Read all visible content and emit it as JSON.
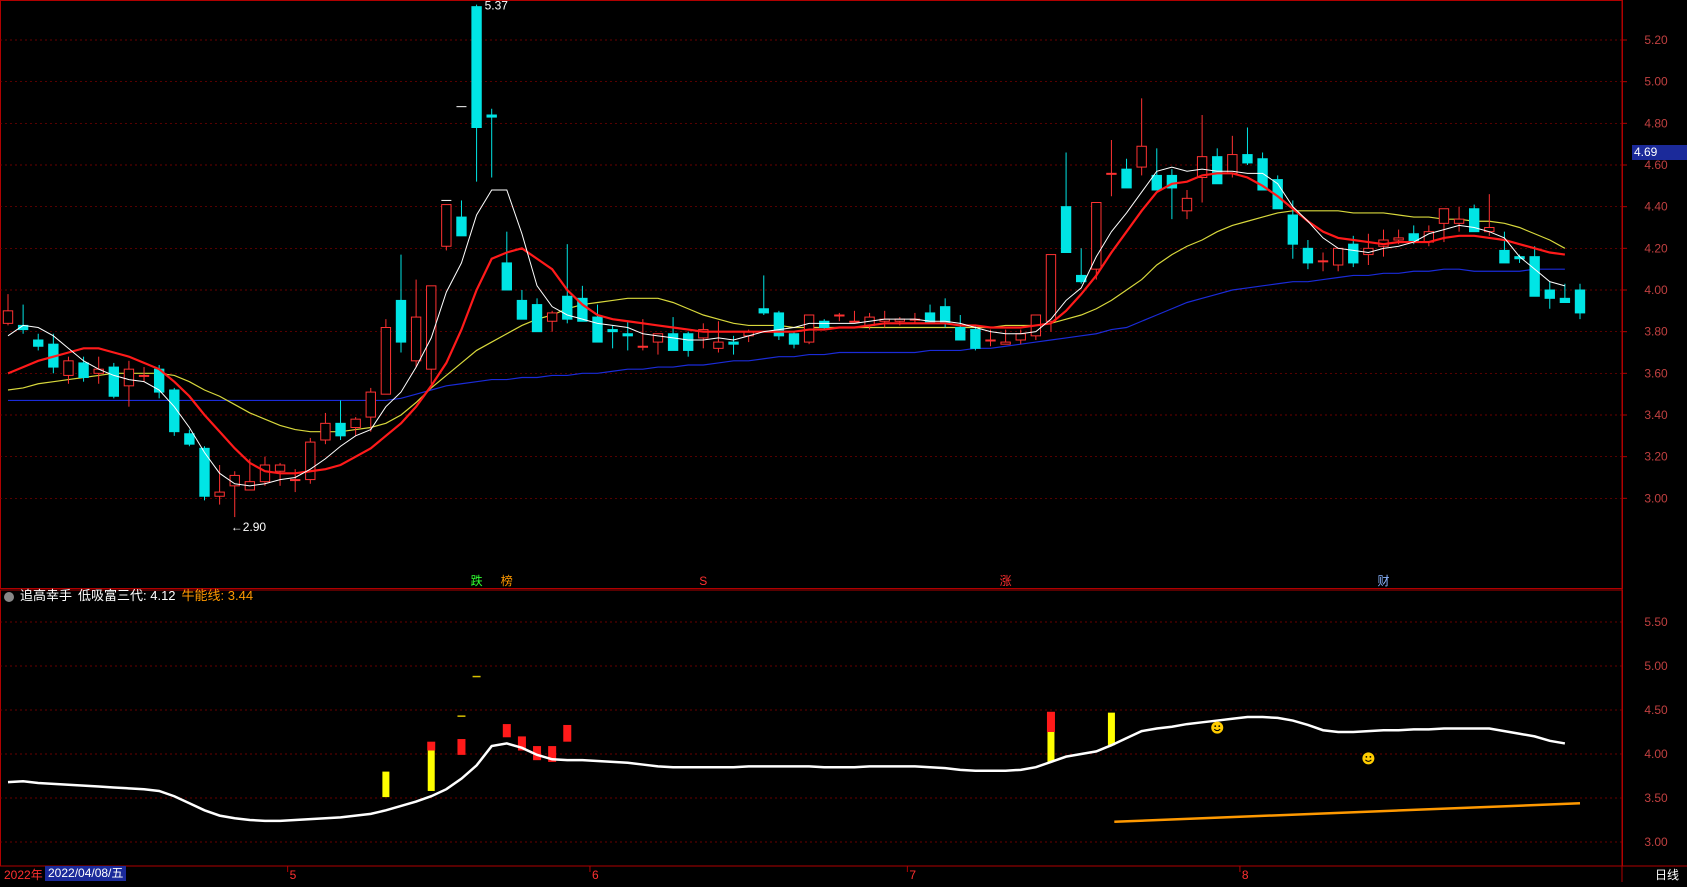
{
  "colors": {
    "up": "#ff3232",
    "down": "#00e5e5",
    "ma5": "#ffffff",
    "ma10": "#ff1a1a",
    "ma20": "#d8d83c",
    "ma60": "#1a2bd8",
    "grid": "#8b0000",
    "axis": "#c0c0c0",
    "sub_line": "#ffffff",
    "sub_niu": "#ff9900"
  },
  "main": {
    "current_price_label": "4.69",
    "high_marker": "5.37",
    "low_marker": "←2.90",
    "event_tags": [
      {
        "text": "跌",
        "color": "#30ff30"
      },
      {
        "text": "榜",
        "color": "#ff9900"
      },
      {
        "text": "S",
        "color": "#ff3030"
      },
      {
        "text": "涨",
        "color": "#ff3030"
      },
      {
        "text": "财",
        "color": "#8ab4ff"
      }
    ]
  },
  "sub": {
    "indicator_name": "追高幸手",
    "line1_label": "低吸富三代: 4.12",
    "line2_label": "牛能线: 3.44",
    "smiley_icon": "smiley-face-icon"
  },
  "xaxis": {
    "year_label": "2022年",
    "cursor_date": "2022/04/08/五",
    "month_labels": [
      "5",
      "6",
      "7",
      "8"
    ],
    "period": "日线"
  },
  "chart_data": [
    {
      "type": "candlestick",
      "title": "",
      "ylim": [
        2.8,
        5.4
      ],
      "yticks": [
        "5.20",
        "5.00",
        "4.80",
        "4.60",
        "4.40",
        "4.20",
        "4.00",
        "3.80",
        "3.60",
        "3.40",
        "3.20",
        "3.00"
      ],
      "candles": [
        [
          3.84,
          3.98,
          3.83,
          3.9
        ],
        [
          3.83,
          3.93,
          3.79,
          3.81
        ],
        [
          3.76,
          3.79,
          3.71,
          3.73
        ],
        [
          3.74,
          3.79,
          3.6,
          3.63
        ],
        [
          3.59,
          3.68,
          3.55,
          3.66
        ],
        [
          3.65,
          3.68,
          3.56,
          3.58
        ],
        [
          3.6,
          3.68,
          3.55,
          3.62
        ],
        [
          3.63,
          3.65,
          3.48,
          3.49
        ],
        [
          3.54,
          3.66,
          3.44,
          3.62
        ],
        [
          3.59,
          3.63,
          3.56,
          3.59
        ],
        [
          3.62,
          3.64,
          3.48,
          3.51
        ],
        [
          3.52,
          3.53,
          3.3,
          3.32
        ],
        [
          3.31,
          3.33,
          3.25,
          3.26
        ],
        [
          3.24,
          3.25,
          2.99,
          3.01
        ],
        [
          3.01,
          3.16,
          2.97,
          3.03
        ],
        [
          3.06,
          3.13,
          2.91,
          3.11
        ],
        [
          3.04,
          3.19,
          3.04,
          3.08
        ],
        [
          3.08,
          3.2,
          3.06,
          3.16
        ],
        [
          3.13,
          3.17,
          3.06,
          3.16
        ],
        [
          3.09,
          3.14,
          3.03,
          3.09
        ],
        [
          3.09,
          3.29,
          3.07,
          3.27
        ],
        [
          3.28,
          3.41,
          3.26,
          3.36
        ],
        [
          3.36,
          3.47,
          3.28,
          3.3
        ],
        [
          3.34,
          3.39,
          3.3,
          3.38
        ],
        [
          3.39,
          3.53,
          3.32,
          3.51
        ],
        [
          3.5,
          3.86,
          3.5,
          3.82
        ],
        [
          3.95,
          4.17,
          3.7,
          3.75
        ],
        [
          3.66,
          4.05,
          3.63,
          3.87
        ],
        [
          3.62,
          4.02,
          3.55,
          4.02
        ],
        [
          4.21,
          4.41,
          4.19,
          4.41
        ],
        [
          4.35,
          4.43,
          4.26,
          4.26
        ],
        [
          5.36,
          5.37,
          4.52,
          4.78
        ],
        [
          4.84,
          4.87,
          4.54,
          4.83
        ],
        [
          4.13,
          4.28,
          4.0,
          4.0
        ],
        [
          3.95,
          4.0,
          3.86,
          3.86
        ],
        [
          3.93,
          3.96,
          3.8,
          3.8
        ],
        [
          3.85,
          3.9,
          3.8,
          3.89
        ],
        [
          3.97,
          4.22,
          3.84,
          3.86
        ],
        [
          3.96,
          4.02,
          3.85,
          3.85
        ],
        [
          3.87,
          3.93,
          3.8,
          3.75
        ],
        [
          3.81,
          3.83,
          3.72,
          3.8
        ],
        [
          3.79,
          3.85,
          3.71,
          3.78
        ],
        [
          3.73,
          3.86,
          3.71,
          3.73
        ],
        [
          3.75,
          3.79,
          3.69,
          3.79
        ],
        [
          3.79,
          3.87,
          3.71,
          3.71
        ],
        [
          3.79,
          3.8,
          3.68,
          3.71
        ],
        [
          3.77,
          3.84,
          3.72,
          3.81
        ],
        [
          3.72,
          3.85,
          3.7,
          3.75
        ],
        [
          3.75,
          3.78,
          3.69,
          3.74
        ],
        [
          3.78,
          3.81,
          3.75,
          3.8
        ],
        [
          3.91,
          4.07,
          3.88,
          3.89
        ],
        [
          3.89,
          3.9,
          3.76,
          3.78
        ],
        [
          3.79,
          3.8,
          3.72,
          3.74
        ],
        [
          3.75,
          3.88,
          3.74,
          3.88
        ],
        [
          3.85,
          3.86,
          3.81,
          3.82
        ],
        [
          3.88,
          3.89,
          3.85,
          3.88
        ],
        [
          3.85,
          3.9,
          3.85,
          3.85
        ],
        [
          3.83,
          3.89,
          3.81,
          3.87
        ],
        [
          3.85,
          3.9,
          3.82,
          3.86
        ],
        [
          3.85,
          3.87,
          3.83,
          3.86
        ],
        [
          3.86,
          3.89,
          3.84,
          3.86
        ],
        [
          3.89,
          3.93,
          3.86,
          3.84
        ],
        [
          3.92,
          3.96,
          3.82,
          3.84
        ],
        [
          3.82,
          3.88,
          3.76,
          3.76
        ],
        [
          3.81,
          3.83,
          3.71,
          3.72
        ],
        [
          3.76,
          3.81,
          3.73,
          3.76
        ],
        [
          3.74,
          3.81,
          3.74,
          3.75
        ],
        [
          3.76,
          3.81,
          3.74,
          3.79
        ],
        [
          3.78,
          3.88,
          3.76,
          3.88
        ],
        [
          3.85,
          4.17,
          3.8,
          4.17
        ],
        [
          4.4,
          4.66,
          4.18,
          4.18
        ],
        [
          4.07,
          4.2,
          4.03,
          4.04
        ],
        [
          4.1,
          4.42,
          4.05,
          4.42
        ],
        [
          4.56,
          4.72,
          4.45,
          4.56
        ],
        [
          4.58,
          4.63,
          4.49,
          4.49
        ],
        [
          4.59,
          4.92,
          4.55,
          4.69
        ],
        [
          4.55,
          4.68,
          4.5,
          4.48
        ],
        [
          4.55,
          4.58,
          4.34,
          4.49
        ],
        [
          4.38,
          4.48,
          4.34,
          4.44
        ],
        [
          4.54,
          4.84,
          4.42,
          4.64
        ],
        [
          4.64,
          4.68,
          4.51,
          4.51
        ],
        [
          4.56,
          4.74,
          4.54,
          4.65
        ],
        [
          4.65,
          4.78,
          4.6,
          4.61
        ],
        [
          4.63,
          4.66,
          4.52,
          4.48
        ],
        [
          4.53,
          4.55,
          4.39,
          4.39
        ],
        [
          4.36,
          4.43,
          4.15,
          4.22
        ],
        [
          4.2,
          4.24,
          4.1,
          4.13
        ],
        [
          4.14,
          4.18,
          4.09,
          4.14
        ],
        [
          4.12,
          4.2,
          4.09,
          4.2
        ],
        [
          4.22,
          4.26,
          4.11,
          4.13
        ],
        [
          4.17,
          4.27,
          4.12,
          4.2
        ],
        [
          4.21,
          4.29,
          4.16,
          4.24
        ],
        [
          4.24,
          4.29,
          4.22,
          4.25
        ],
        [
          4.27,
          4.31,
          4.22,
          4.23
        ],
        [
          4.23,
          4.31,
          4.21,
          4.28
        ],
        [
          4.32,
          4.38,
          4.23,
          4.39
        ],
        [
          4.32,
          4.4,
          4.28,
          4.34
        ],
        [
          4.39,
          4.41,
          4.28,
          4.28
        ],
        [
          4.28,
          4.46,
          4.26,
          4.3
        ],
        [
          4.19,
          4.28,
          4.15,
          4.13
        ],
        [
          4.16,
          4.17,
          4.13,
          4.15
        ],
        [
          4.16,
          4.21,
          3.98,
          3.97
        ],
        [
          4.0,
          4.04,
          3.91,
          3.96
        ],
        [
          3.96,
          4.03,
          3.94,
          3.94
        ],
        [
          4.0,
          4.03,
          3.86,
          3.89
        ]
      ],
      "ma5": [
        3.78,
        3.83,
        3.82,
        3.78,
        3.72,
        3.66,
        3.62,
        3.59,
        3.57,
        3.56,
        3.52,
        3.44,
        3.34,
        3.22,
        3.12,
        3.07,
        3.06,
        3.07,
        3.09,
        3.1,
        3.14,
        3.19,
        3.25,
        3.3,
        3.33,
        3.44,
        3.51,
        3.63,
        3.77,
        3.99,
        4.13,
        4.36,
        4.48,
        4.48,
        4.27,
        4.02,
        3.92,
        3.88,
        3.86,
        3.84,
        3.83,
        3.82,
        3.79,
        3.78,
        3.77,
        3.76,
        3.76,
        3.77,
        3.76,
        3.78,
        3.8,
        3.81,
        3.82,
        3.84,
        3.84,
        3.84,
        3.84,
        3.85,
        3.86,
        3.86,
        3.86,
        3.85,
        3.85,
        3.84,
        3.82,
        3.8,
        3.79,
        3.79,
        3.8,
        3.86,
        3.95,
        4.01,
        4.16,
        4.28,
        4.37,
        4.47,
        4.57,
        4.59,
        4.57,
        4.58,
        4.57,
        4.57,
        4.56,
        4.56,
        4.51,
        4.4,
        4.33,
        4.25,
        4.2,
        4.19,
        4.18,
        4.2,
        4.21,
        4.23,
        4.27,
        4.29,
        4.31,
        4.3,
        4.28,
        4.25,
        4.16,
        4.1,
        4.04,
        4.02
      ],
      "ma10": [
        3.6,
        3.63,
        3.66,
        3.68,
        3.7,
        3.72,
        3.72,
        3.7,
        3.68,
        3.65,
        3.62,
        3.56,
        3.49,
        3.4,
        3.32,
        3.24,
        3.17,
        3.13,
        3.12,
        3.12,
        3.13,
        3.14,
        3.16,
        3.2,
        3.24,
        3.3,
        3.36,
        3.44,
        3.54,
        3.65,
        3.81,
        4.0,
        4.15,
        4.18,
        4.2,
        4.15,
        4.1,
        4.0,
        3.93,
        3.88,
        3.86,
        3.85,
        3.84,
        3.83,
        3.82,
        3.81,
        3.8,
        3.8,
        3.8,
        3.8,
        3.8,
        3.8,
        3.8,
        3.81,
        3.81,
        3.82,
        3.82,
        3.83,
        3.84,
        3.84,
        3.84,
        3.84,
        3.84,
        3.83,
        3.83,
        3.82,
        3.82,
        3.82,
        3.83,
        3.84,
        3.9,
        3.98,
        4.07,
        4.18,
        4.28,
        4.38,
        4.47,
        4.51,
        4.52,
        4.55,
        4.56,
        4.56,
        4.54,
        4.5,
        4.45,
        4.39,
        4.33,
        4.28,
        4.25,
        4.24,
        4.23,
        4.22,
        4.23,
        4.23,
        4.23,
        4.25,
        4.26,
        4.26,
        4.25,
        4.24,
        4.22,
        4.2,
        4.18,
        4.17
      ],
      "ma20": [
        3.52,
        3.53,
        3.55,
        3.56,
        3.57,
        3.58,
        3.59,
        3.6,
        3.6,
        3.6,
        3.6,
        3.59,
        3.56,
        3.52,
        3.49,
        3.45,
        3.41,
        3.38,
        3.35,
        3.33,
        3.32,
        3.32,
        3.32,
        3.33,
        3.34,
        3.36,
        3.4,
        3.46,
        3.53,
        3.59,
        3.65,
        3.71,
        3.75,
        3.79,
        3.83,
        3.86,
        3.88,
        3.91,
        3.93,
        3.94,
        3.95,
        3.96,
        3.96,
        3.96,
        3.94,
        3.91,
        3.88,
        3.86,
        3.84,
        3.83,
        3.83,
        3.83,
        3.82,
        3.82,
        3.82,
        3.82,
        3.82,
        3.82,
        3.82,
        3.82,
        3.82,
        3.82,
        3.82,
        3.82,
        3.82,
        3.82,
        3.83,
        3.83,
        3.83,
        3.84,
        3.86,
        3.88,
        3.91,
        3.95,
        4.0,
        4.05,
        4.12,
        4.17,
        4.21,
        4.24,
        4.28,
        4.31,
        4.33,
        4.35,
        4.37,
        4.38,
        4.38,
        4.38,
        4.38,
        4.37,
        4.37,
        4.37,
        4.36,
        4.35,
        4.35,
        4.34,
        4.34,
        4.33,
        4.33,
        4.32,
        4.3,
        4.27,
        4.24,
        4.2
      ],
      "ma60": [
        3.47,
        3.47,
        3.47,
        3.47,
        3.47,
        3.47,
        3.47,
        3.47,
        3.47,
        3.47,
        3.47,
        3.47,
        3.47,
        3.47,
        3.47,
        3.47,
        3.47,
        3.47,
        3.47,
        3.47,
        3.47,
        3.47,
        3.47,
        3.47,
        3.47,
        3.47,
        3.48,
        3.5,
        3.52,
        3.54,
        3.55,
        3.56,
        3.57,
        3.57,
        3.58,
        3.58,
        3.59,
        3.59,
        3.6,
        3.6,
        3.61,
        3.62,
        3.62,
        3.63,
        3.63,
        3.64,
        3.64,
        3.65,
        3.66,
        3.66,
        3.67,
        3.68,
        3.68,
        3.69,
        3.69,
        3.7,
        3.7,
        3.7,
        3.7,
        3.7,
        3.7,
        3.71,
        3.71,
        3.71,
        3.72,
        3.72,
        3.73,
        3.74,
        3.75,
        3.76,
        3.77,
        3.78,
        3.79,
        3.81,
        3.82,
        3.85,
        3.88,
        3.91,
        3.94,
        3.96,
        3.98,
        4.0,
        4.01,
        4.02,
        4.03,
        4.04,
        4.04,
        4.05,
        4.06,
        4.07,
        4.07,
        4.08,
        4.08,
        4.09,
        4.09,
        4.1,
        4.1,
        4.09,
        4.09,
        4.09,
        4.09,
        4.1,
        4.1,
        4.1
      ]
    },
    {
      "type": "line",
      "title": "追高幸手",
      "ylim": [
        2.8,
        5.8
      ],
      "yticks": [
        "5.50",
        "5.00",
        "4.50",
        "4.00",
        "3.50",
        "3.00"
      ],
      "series": [
        {
          "name": "低吸富三代",
          "last": 4.12,
          "values": [
            3.68,
            3.69,
            3.67,
            3.66,
            3.65,
            3.64,
            3.63,
            3.62,
            3.61,
            3.6,
            3.58,
            3.52,
            3.44,
            3.36,
            3.3,
            3.27,
            3.25,
            3.24,
            3.24,
            3.25,
            3.26,
            3.27,
            3.28,
            3.3,
            3.32,
            3.36,
            3.41,
            3.46,
            3.52,
            3.6,
            3.72,
            3.87,
            4.09,
            4.12,
            4.07,
            3.99,
            3.94,
            3.93,
            3.93,
            3.92,
            3.91,
            3.9,
            3.88,
            3.86,
            3.85,
            3.85,
            3.85,
            3.85,
            3.85,
            3.86,
            3.86,
            3.86,
            3.86,
            3.86,
            3.85,
            3.85,
            3.85,
            3.86,
            3.86,
            3.86,
            3.86,
            3.85,
            3.84,
            3.82,
            3.81,
            3.81,
            3.81,
            3.82,
            3.85,
            3.91,
            3.97,
            4.0,
            4.03,
            4.1,
            4.18,
            4.26,
            4.29,
            4.31,
            4.34,
            4.36,
            4.38,
            4.4,
            4.42,
            4.42,
            4.41,
            4.38,
            4.33,
            4.27,
            4.25,
            4.25,
            4.26,
            4.27,
            4.27,
            4.28,
            4.28,
            4.29,
            4.29,
            4.29,
            4.29,
            4.26,
            4.23,
            4.2,
            4.15,
            4.12
          ]
        },
        {
          "name": "牛能线",
          "last": 3.44,
          "start": 3.23,
          "start_index": 72
        }
      ],
      "red_bars": [
        [
          28,
          4.14,
          4.04
        ],
        [
          30,
          4.17,
          3.99
        ],
        [
          33,
          4.34,
          4.19
        ],
        [
          34,
          4.2,
          4.04
        ],
        [
          35,
          4.09,
          3.93
        ],
        [
          36,
          4.09,
          3.91
        ],
        [
          37,
          4.33,
          4.14
        ],
        [
          69,
          4.48,
          4.25
        ]
      ],
      "yellow_bars": [
        [
          25,
          3.8,
          3.51
        ],
        [
          28,
          4.04,
          3.58
        ],
        [
          69,
          4.25,
          3.91
        ],
        [
          73,
          4.47,
          4.1
        ]
      ],
      "markers": [
        [
          31,
          4.88,
          "-"
        ],
        [
          30,
          4.43,
          "-"
        ]
      ],
      "smileys": [
        [
          80,
          4.3
        ],
        [
          90,
          3.95
        ]
      ]
    }
  ]
}
